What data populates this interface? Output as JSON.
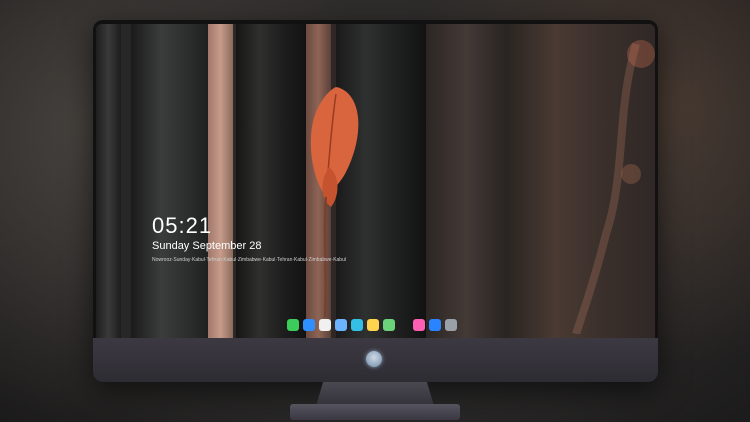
{
  "lockscreen": {
    "time": "05:21",
    "date": "Sunday September 28",
    "ticker": "Nowrooz·Sunday·Kabul·Tehran·Kabul·Zimbabwe·Kabul·Tehran·Kabul·Zimbabwe·Kabul"
  },
  "dock": {
    "apps": [
      {
        "name": "messages-icon",
        "color": "#3ccc5c"
      },
      {
        "name": "finder-icon",
        "color": "#2f8fff"
      },
      {
        "name": "safari-icon",
        "color": "#f0f0f0"
      },
      {
        "name": "preview-icon",
        "color": "#6bb3ff"
      },
      {
        "name": "photos-icon",
        "color": "#34c0e6"
      },
      {
        "name": "notes-icon",
        "color": "#ffd34e"
      },
      {
        "name": "maps-icon",
        "color": "#6cd27a"
      },
      {
        "name": "music-icon",
        "color": "#ff5fb3"
      },
      {
        "name": "appstore-icon",
        "color": "#2b84ff"
      },
      {
        "name": "camera-icon",
        "color": "#9aa0a8"
      }
    ]
  }
}
